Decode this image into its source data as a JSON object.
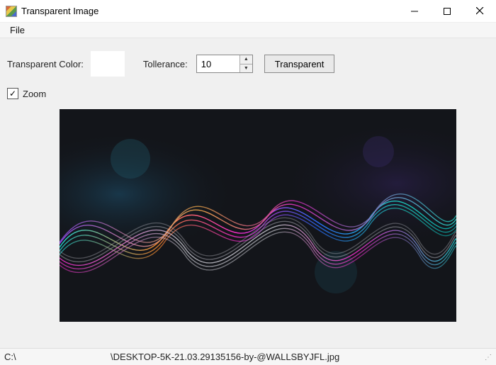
{
  "window": {
    "title": "Transparent Image"
  },
  "menu": {
    "file": "File"
  },
  "toolbar": {
    "transparent_color_label": "Transparent Color:",
    "swatch_color": "#ffffff",
    "tolerance_label": "Tollerance:",
    "tolerance_value": "10",
    "transparent_button": "Transparent"
  },
  "zoom": {
    "checked": true,
    "label": "Zoom"
  },
  "status": {
    "left": "C:\\",
    "path": "\\DESKTOP-5K-21.03.29135156-by-@WALLSBYJFL.jpg"
  }
}
